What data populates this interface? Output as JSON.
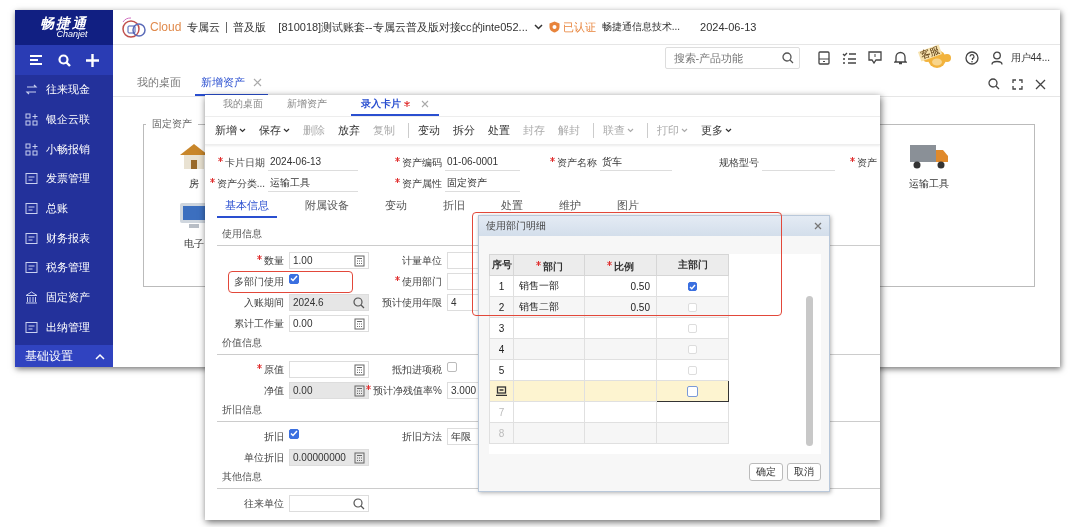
{
  "app": {
    "logo": {
      "name": "畅捷通",
      "sub": "Chanjet"
    },
    "sidebar": {
      "items": [
        {
          "label": "往来现金",
          "kind": "transfer"
        },
        {
          "label": "银企云联",
          "kind": "nodes"
        },
        {
          "label": "小畅报销",
          "kind": "nodes"
        },
        {
          "label": "发票管理",
          "kind": "invoice"
        },
        {
          "label": "总账",
          "kind": "ledger"
        },
        {
          "label": "财务报表",
          "kind": "report"
        },
        {
          "label": "税务管理",
          "kind": "invoice"
        },
        {
          "label": "固定资产",
          "kind": "bank"
        },
        {
          "label": "出纳管理",
          "kind": "cashier"
        }
      ],
      "footer": {
        "label": "基础设置"
      }
    },
    "header": {
      "brand": "Cloud",
      "edition_type": "专属云",
      "edition": "普及版",
      "account": "[810018]测试账套--专属云普及版对接cc的inte052...",
      "certified": "已认证",
      "company": "畅捷通信息技术...",
      "date": "2024-06-13"
    },
    "search": {
      "placeholder": "搜索-产品功能"
    },
    "service_badge": "客服",
    "user": "用户44...",
    "tabs": [
      {
        "label": "我的桌面",
        "selected": false
      },
      {
        "label": "新增资产",
        "selected": true
      }
    ],
    "panel": {
      "legend": "固定资产",
      "items": [
        {
          "kind": "house",
          "label": "房"
        },
        {
          "kind": "computer",
          "label": "电子"
        },
        {
          "kind": "truck",
          "label": "运输工具"
        }
      ]
    }
  },
  "card_window": {
    "tabs": [
      {
        "label": "我的桌面",
        "selected": false,
        "modified": false
      },
      {
        "label": "新增资产",
        "selected": false,
        "modified": false
      },
      {
        "label": "录入卡片",
        "selected": true,
        "modified": true
      }
    ],
    "toolbar": [
      {
        "label": "新增",
        "dropdown": true,
        "disabled": false,
        "separator_before": false
      },
      {
        "label": "保存",
        "dropdown": true,
        "disabled": false,
        "separator_before": false
      },
      {
        "label": "删除",
        "dropdown": false,
        "disabled": true,
        "separator_before": false
      },
      {
        "label": "放弃",
        "dropdown": false,
        "disabled": false,
        "separator_before": false
      },
      {
        "label": "复制",
        "dropdown": false,
        "disabled": true,
        "separator_before": false
      },
      {
        "label": "变动",
        "dropdown": false,
        "disabled": false,
        "separator_before": true
      },
      {
        "label": "拆分",
        "dropdown": false,
        "disabled": false,
        "separator_before": false
      },
      {
        "label": "处置",
        "dropdown": false,
        "disabled": false,
        "separator_before": false
      },
      {
        "label": "封存",
        "dropdown": false,
        "disabled": true,
        "separator_before": false
      },
      {
        "label": "解封",
        "dropdown": false,
        "disabled": true,
        "separator_before": false
      },
      {
        "label": "联查",
        "dropdown": true,
        "disabled": true,
        "separator_before": true
      },
      {
        "label": "打印",
        "dropdown": true,
        "disabled": true,
        "separator_before": true
      },
      {
        "label": "更多",
        "dropdown": true,
        "disabled": false,
        "separator_before": false
      }
    ],
    "header_fields": [
      {
        "label": "卡片日期",
        "required": true,
        "value": "2024-06-13"
      },
      {
        "label": "资产编码",
        "required": true,
        "value": "01-06-0001"
      },
      {
        "label": "资产名称",
        "required": true,
        "value": "货车"
      },
      {
        "label": "规格型号",
        "required": false
      },
      {
        "label": "资产",
        "required": true
      },
      {
        "label": "资产分类...",
        "required": true,
        "value": "运输工具"
      },
      {
        "label": "资产属性",
        "required": true,
        "value": "固定资产"
      }
    ],
    "subtabs": [
      {
        "label": "基本信息",
        "selected": true
      },
      {
        "label": "附属设备",
        "selected": false
      },
      {
        "label": "变动",
        "selected": false
      },
      {
        "label": "折旧",
        "selected": false
      },
      {
        "label": "处置",
        "selected": false
      },
      {
        "label": "维护",
        "selected": false
      },
      {
        "label": "图片",
        "selected": false
      }
    ],
    "sections": [
      {
        "title": "使用信息",
        "rows": [
          [
            {
              "label": "数量",
              "required": true,
              "kind": "calc",
              "value": "1.00",
              "readonly": false
            },
            {
              "label": "计量单位",
              "required": false,
              "kind": "text",
              "readonly": false
            }
          ],
          [
            {
              "label": "多部门使用",
              "required": false,
              "kind": "checkbox",
              "checked": true
            },
            {
              "label": "使用部门",
              "required": true,
              "kind": "text",
              "readonly": false
            }
          ],
          [
            {
              "label": "入账期间",
              "required": false,
              "kind": "search",
              "value": "2024.6",
              "readonly": true
            },
            {
              "label": "预计使用年限",
              "required": false,
              "kind": "text",
              "value": "4",
              "readonly": false
            }
          ],
          [
            {
              "label": "累计工作量",
              "required": false,
              "kind": "calc",
              "value": "0.00",
              "readonly": false
            }
          ]
        ]
      },
      {
        "title": "价值信息",
        "rows": [
          [
            {
              "label": "原值",
              "required": true,
              "kind": "calc",
              "readonly": false
            },
            {
              "label": "抵扣进项税",
              "required": false,
              "kind": "checkbox",
              "checked": false
            }
          ],
          [
            {
              "label": "净值",
              "required": false,
              "kind": "calc",
              "value": "0.00",
              "readonly": true
            },
            {
              "label": "预计净残值率%",
              "required": true,
              "kind": "text",
              "value": "3.000",
              "readonly": false
            }
          ]
        ]
      },
      {
        "title": "折旧信息",
        "rows": [
          [
            {
              "label": "折旧",
              "required": false,
              "kind": "checkbox",
              "checked": true
            },
            {
              "label": "折旧方法",
              "required": false,
              "kind": "text",
              "value": "年限",
              "readonly": false
            }
          ],
          [
            {
              "label": "单位折旧",
              "required": false,
              "kind": "calc",
              "value": "0.00000000",
              "readonly": true
            }
          ]
        ]
      },
      {
        "title": "其他信息",
        "rows": [
          [
            {
              "label": "往来单位",
              "required": false,
              "kind": "search",
              "readonly": false
            }
          ]
        ]
      }
    ]
  },
  "dialog": {
    "title": "使用部门明细",
    "columns": [
      {
        "label": "序号",
        "required": false
      },
      {
        "label": "部门",
        "required": true
      },
      {
        "label": "比例",
        "required": true
      },
      {
        "label": "主部门",
        "required": false
      }
    ],
    "rows": [
      {
        "seq": "1",
        "department": "销售一部",
        "ratio": "0.50",
        "checked": true,
        "selected": false,
        "disabled": false
      },
      {
        "seq": "2",
        "department": "销售二部",
        "ratio": "0.50",
        "checked": false,
        "selected": false,
        "disabled": false
      },
      {
        "seq": "3",
        "checked": false,
        "selected": false,
        "disabled": false
      },
      {
        "seq": "4",
        "checked": false,
        "selected": false,
        "disabled": false
      },
      {
        "seq": "5",
        "checked": false,
        "selected": false,
        "disabled": false
      },
      {
        "checked": false,
        "selected": true,
        "disabled": false
      },
      {
        "seq": "7",
        "selected": false,
        "disabled": true
      },
      {
        "seq": "8",
        "selected": false,
        "disabled": true
      }
    ],
    "buttons": [
      "确定",
      "取消"
    ]
  }
}
